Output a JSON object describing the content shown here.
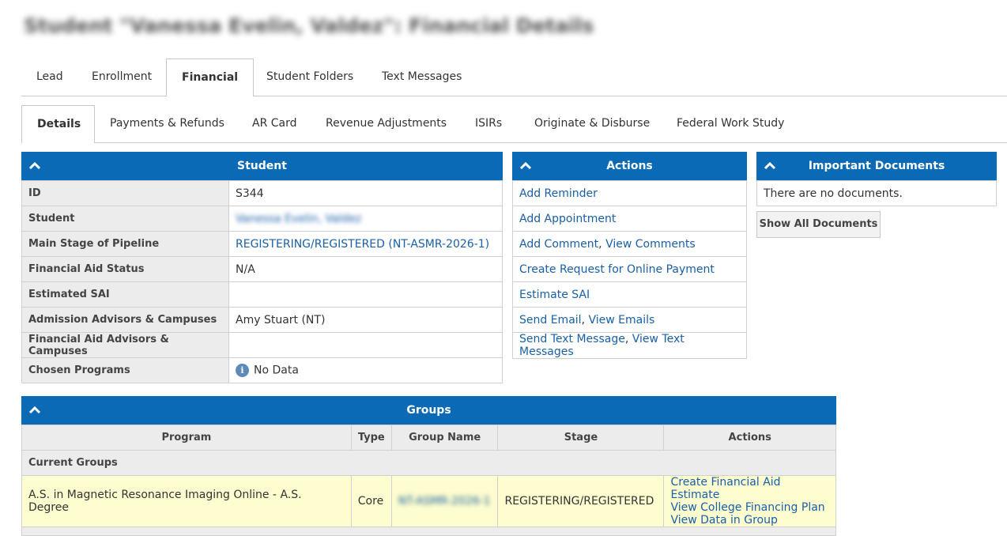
{
  "page_title": "Student \"Vanessa Evelin, Valdez\": Financial Details",
  "main_tabs": [
    "Lead",
    "Enrollment",
    "Financial",
    "Student Folders",
    "Text Messages"
  ],
  "sub_tabs": [
    "Details",
    "Payments & Refunds",
    "AR Card",
    "Revenue Adjustments",
    "ISIRs",
    "Originate & Disburse",
    "Federal Work Study"
  ],
  "student_panel": {
    "title": "Student",
    "rows": [
      {
        "label": "ID",
        "value": "S344"
      },
      {
        "label": "Student",
        "value": "Vanessa Evelin, Valdez"
      },
      {
        "label": "Main Stage of Pipeline",
        "value": "REGISTERING/REGISTERED (NT-ASMR-2026-1)"
      },
      {
        "label": "Financial Aid Status",
        "value": "N/A"
      },
      {
        "label": "Estimated SAI",
        "value": ""
      },
      {
        "label": "Admission Advisors & Campuses",
        "value": "Amy Stuart (NT)"
      },
      {
        "label": "Financial Aid Advisors & Campuses",
        "value": ""
      },
      {
        "label": "Chosen Programs",
        "value": "No Data"
      }
    ]
  },
  "actions_panel": {
    "title": "Actions",
    "add_reminder": "Add Reminder",
    "add_appointment": "Add Appointment",
    "add_comment": "Add Comment",
    "view_comments": "View Comments",
    "create_request": "Create Request for Online Payment",
    "estimate_sai": "Estimate SAI",
    "send_email": "Send Email",
    "view_emails": "View Emails",
    "send_text": "Send Text Message",
    "view_texts": "View Text Messages",
    "separator": ","
  },
  "documents_panel": {
    "title": "Important Documents",
    "empty_text": "There are no documents.",
    "show_all": "Show All Documents"
  },
  "groups_panel": {
    "title": "Groups",
    "headers": [
      "Program",
      "Type",
      "Group Name",
      "Stage",
      "Actions"
    ],
    "section": "Current Groups",
    "row": {
      "program": "A.S. in Magnetic Resonance Imaging Online - A.S. Degree",
      "type": "Core",
      "group_name": "NT-ASMR-2026-1",
      "stage": "REGISTERING/REGISTERED",
      "actions": [
        "Create Financial Aid Estimate",
        "View College Financing Plan",
        "View Data in Group"
      ]
    }
  },
  "colors": {
    "header_blue": "#0a6ab5",
    "link": "#1a5fa6",
    "highlight_row": "#fdfdcf",
    "label_bg": "#ececec"
  }
}
